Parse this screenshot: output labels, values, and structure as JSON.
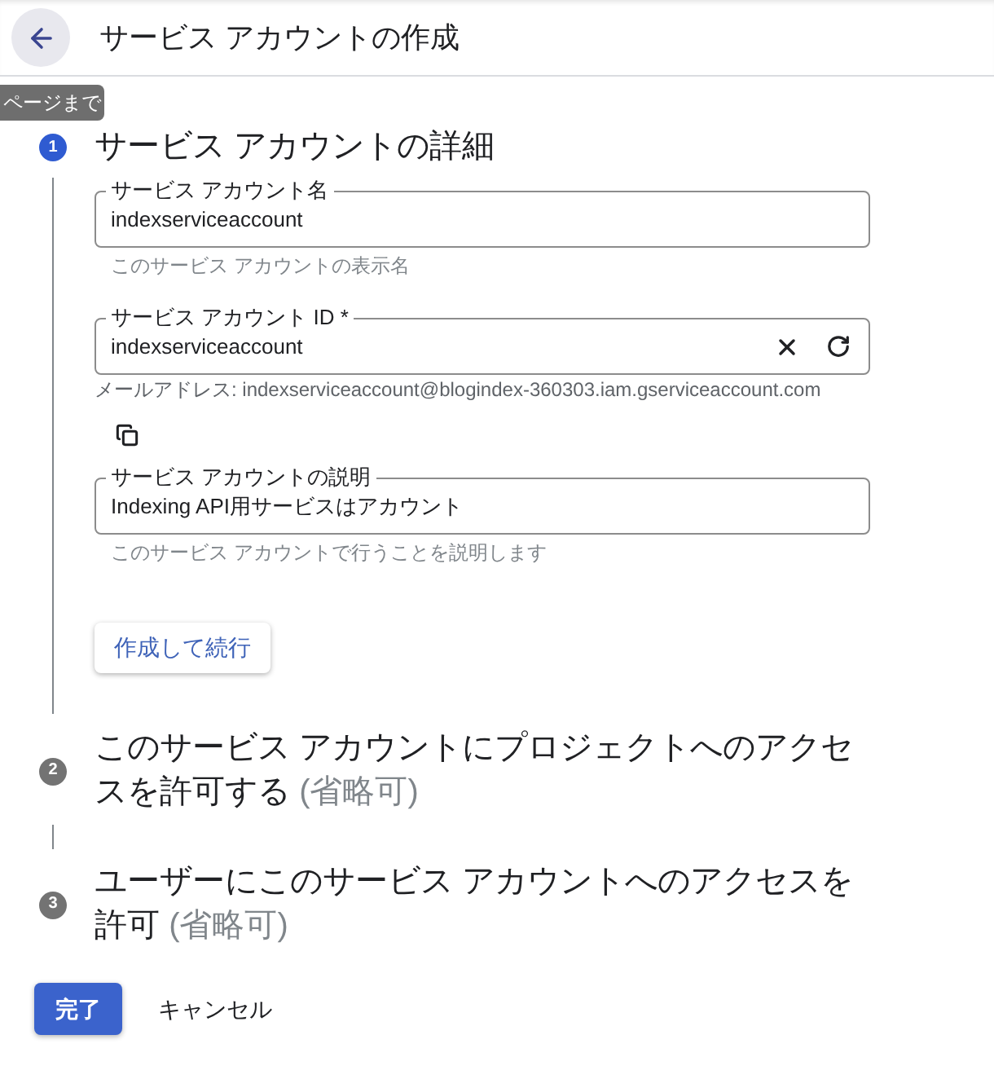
{
  "header": {
    "title": "サービス アカウントの作成"
  },
  "tooltip": {
    "text": "ページまで"
  },
  "steps": [
    {
      "number": "1",
      "title": "サービス アカウントの詳細",
      "active": true,
      "fields": [
        {
          "kind": "text",
          "label": "サービス アカウント名",
          "value": "indexserviceaccount",
          "helper": "このサービス アカウントの表示名"
        },
        {
          "kind": "id",
          "label": "サービス アカウント ID *",
          "value": "indexserviceaccount",
          "note": "メールアドレス: indexserviceaccount@blogindex-360303.iam.gserviceaccount.com"
        },
        {
          "kind": "text",
          "label": "サービス アカウントの説明",
          "value": "Indexing API用サービスはアカウント",
          "helper": "このサービス アカウントで行うことを説明します"
        }
      ],
      "continue_button": "作成して続行"
    },
    {
      "number": "2",
      "title": "このサービス アカウントにプロジェクトへのアクセスを許可する",
      "optional": "(省略可)",
      "active": false
    },
    {
      "number": "3",
      "title": "ユーザーにこのサービス アカウントへのアクセスを許可",
      "optional": "(省略可)",
      "active": false
    }
  ],
  "actions": [
    {
      "kind": "primary",
      "label": "完了"
    },
    {
      "kind": "text",
      "label": "キャンセル"
    }
  ]
}
